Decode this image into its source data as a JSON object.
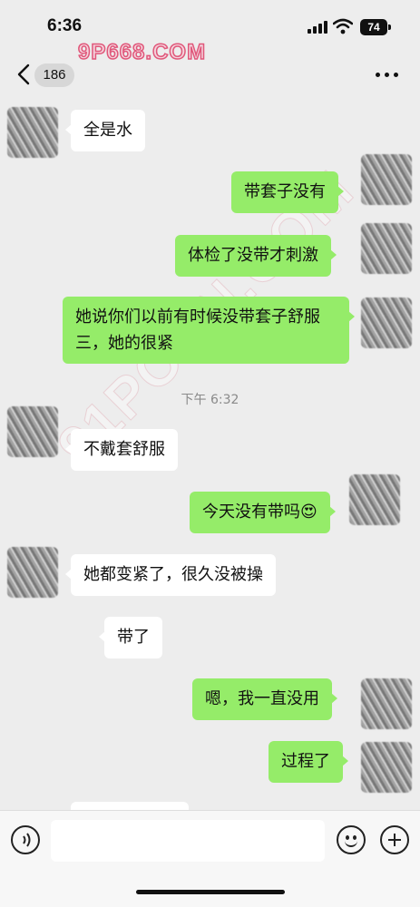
{
  "status_bar": {
    "time": "6:36",
    "battery": "74"
  },
  "nav": {
    "unread_count": "186"
  },
  "watermarks": {
    "top": "9P668.COM",
    "diagonal": "91PORN.COM"
  },
  "chat": {
    "messages": [
      {
        "side": "left",
        "text": "全是水"
      },
      {
        "side": "right",
        "text": "带套子没有"
      },
      {
        "side": "right",
        "text": "体检了没带才刺激"
      },
      {
        "side": "right",
        "text": "她说你们以前有时候没带套子舒服三，她的很紧"
      },
      {
        "side": "left",
        "text": "不戴套舒服"
      },
      {
        "side": "right",
        "text": "今天没有带吗😍"
      },
      {
        "side": "left",
        "text": "她都变紧了，很久没被操"
      },
      {
        "side": "left",
        "text": "带了"
      },
      {
        "side": "right",
        "text": "嗯，我一直没用"
      },
      {
        "side": "right",
        "text": "过程了"
      }
    ],
    "timestamp": "下午 6:32"
  },
  "input_bar": {
    "placeholder": ""
  },
  "colors": {
    "sent_bubble": "#95ec69",
    "received_bubble": "#ffffff",
    "background": "#ededed"
  }
}
